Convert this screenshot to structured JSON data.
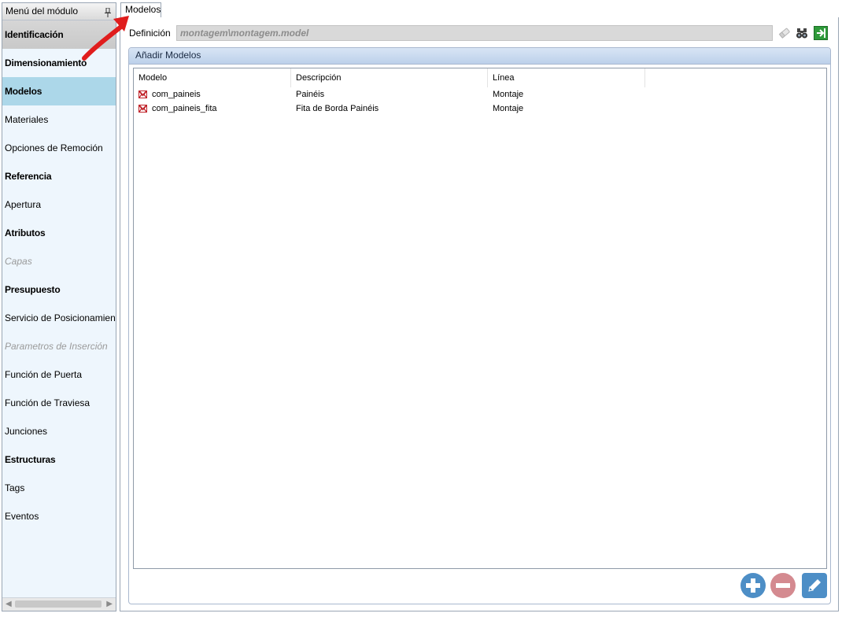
{
  "sidebar": {
    "title": "Menú del módulo",
    "items": [
      {
        "label": "Identificación",
        "style": "bold header"
      },
      {
        "label": "Dimensionamiento",
        "style": "bold"
      },
      {
        "label": "Modelos",
        "style": "bold selected"
      },
      {
        "label": "Materiales",
        "style": "normal"
      },
      {
        "label": "Opciones de Remoción",
        "style": "normal"
      },
      {
        "label": "Referencia",
        "style": "bold"
      },
      {
        "label": "Apertura",
        "style": "normal"
      },
      {
        "label": "Atributos",
        "style": "bold"
      },
      {
        "label": "Capas",
        "style": "disabled"
      },
      {
        "label": "Presupuesto",
        "style": "bold"
      },
      {
        "label": "Servicio de Posicionamiento",
        "style": "normal"
      },
      {
        "label": "Parametros de Inserción",
        "style": "disabled"
      },
      {
        "label": "Función de Puerta",
        "style": "normal"
      },
      {
        "label": "Función de Traviesa",
        "style": "normal"
      },
      {
        "label": "Junciones",
        "style": "normal"
      },
      {
        "label": "Estructuras",
        "style": "bold"
      },
      {
        "label": "Tags",
        "style": "normal"
      },
      {
        "label": "Eventos",
        "style": "normal"
      }
    ]
  },
  "tabs": [
    {
      "label": "Modelos",
      "active": true
    }
  ],
  "definition": {
    "label": "Definición",
    "value": "montagem\\montagem.model"
  },
  "group": {
    "title": "Añadir Modelos",
    "columns": [
      "Modelo",
      "Descripción",
      "Línea"
    ],
    "rows": [
      {
        "modelo": "com_paineis",
        "descripcion": "Painéis",
        "linea": "Montaje"
      },
      {
        "modelo": "com_paineis_fita",
        "descripcion": "Fita de Borda Painéis",
        "linea": "Montaje"
      }
    ]
  },
  "icons": {
    "pin": "pin-icon",
    "eraser": "eraser-icon",
    "binoculars": "binoculars-icon",
    "go": "go-arrow-icon",
    "add": "plus-icon",
    "remove": "minus-icon",
    "edit": "pencil-icon",
    "model": "model-icon"
  },
  "colors": {
    "selected": "#acd7e9",
    "accent_blue": "#4d8ec6",
    "remove_red": "#d48a90",
    "arrow_red": "#e01d1d"
  }
}
